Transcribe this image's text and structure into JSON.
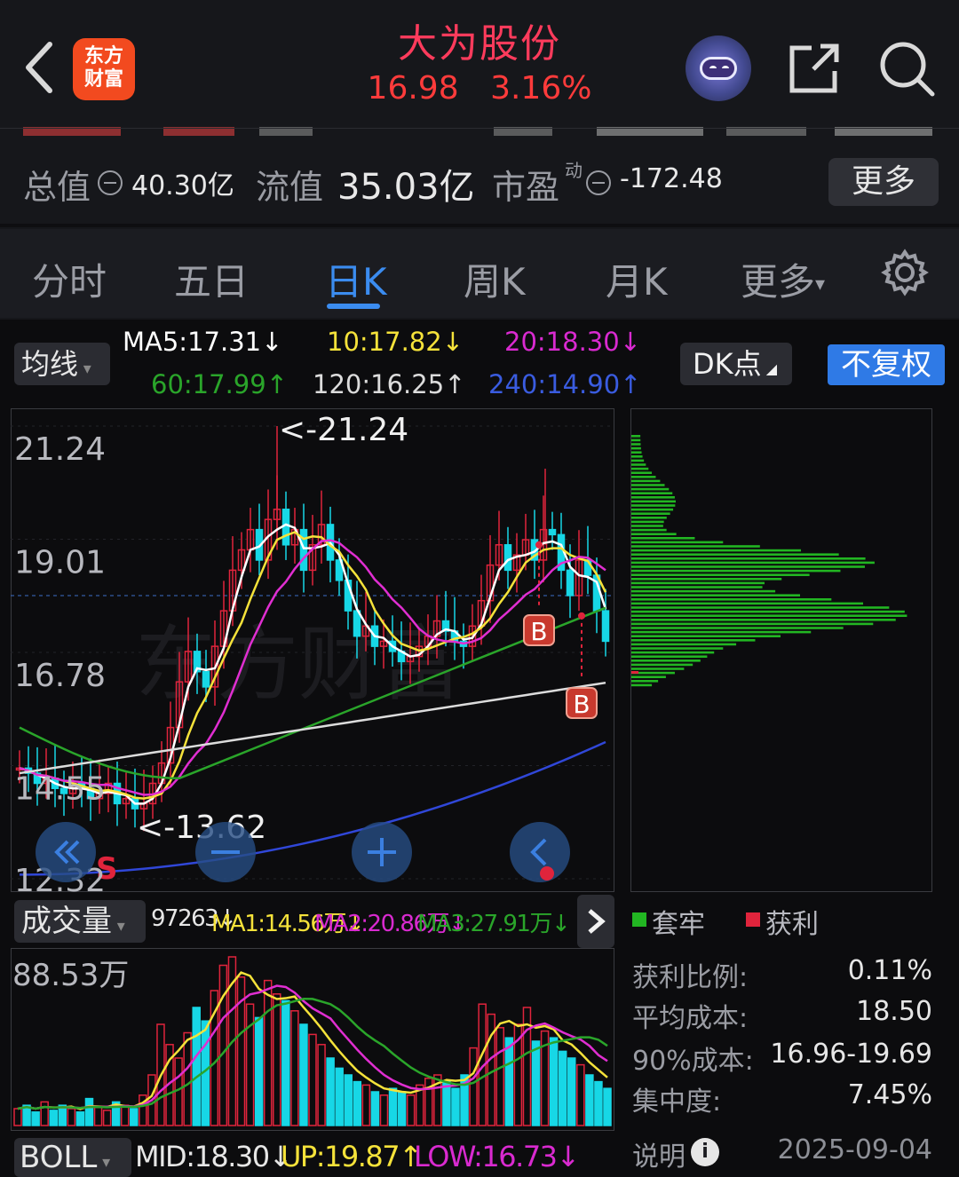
{
  "header": {
    "name": "大为股份",
    "price": "16.98",
    "change_pct": "3.16%",
    "logo_text": [
      "东方",
      "财富"
    ]
  },
  "valuation": {
    "total_label": "总值",
    "total_value": "40.30亿",
    "float_label": "流值",
    "float_value": "35.03亿",
    "pe_label": "市盈",
    "pe_sup": "动",
    "pe_value": "-172.48",
    "more_label": "更多"
  },
  "tabs": [
    "分时",
    "五日",
    "日K",
    "周K",
    "月K",
    "更多"
  ],
  "ma": {
    "button": "均线",
    "ma5": "MA5:17.31↓",
    "ma10": "10:17.82↓",
    "ma20": "20:18.30↓",
    "ma60": "60:17.99↑",
    "ma120": "120:16.25↑",
    "ma240": "240:14.90↑",
    "dk_button": "DK点",
    "fq_button": "不复权",
    "colors": {
      "ma5": "#ffffff",
      "ma10": "#f5e23a",
      "ma20": "#e02ed1",
      "ma60": "#2aa52a",
      "ma120": "#dcdcdc",
      "ma240": "#3047d8"
    }
  },
  "kline": {
    "axis": [
      "21.24",
      "19.01",
      "16.78",
      "14.55",
      "12.32"
    ],
    "high_note": "<-21.24",
    "low_note": "<-13.62",
    "sell_mark": "S",
    "buy_marks": [
      "B",
      "B"
    ]
  },
  "chip": {
    "legend_trapped": "套牢",
    "legend_profit": "获利",
    "profit_ratio_label": "获利比例:",
    "profit_ratio": "0.11%",
    "avg_cost_label": "平均成本:",
    "avg_cost": "18.50",
    "cost90_label": "90%成本:",
    "cost90": "16.96-19.69",
    "concentration_label": "集中度:",
    "concentration": "7.45%",
    "note_label": "说明",
    "date": "2025-09-04"
  },
  "volume": {
    "button": "成交量",
    "vol": "97263↓",
    "ma1": "MA1:14.56万↓",
    "ma2": "MA2:20.86万↓",
    "ma3": "MA3:27.91万↓",
    "axis_top": "88.53万"
  },
  "boll": {
    "button": "BOLL",
    "mid": "MID:18.30↓",
    "up": "UP:19.87↑",
    "low": "LOW:16.73↓"
  }
}
